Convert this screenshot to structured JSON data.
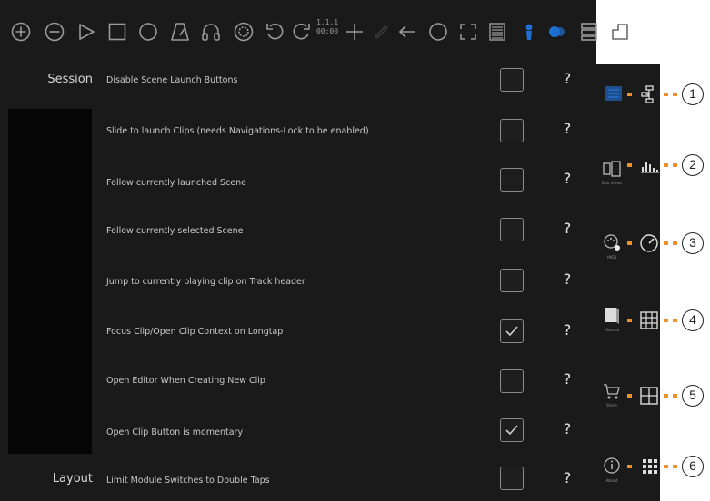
{
  "toolbar": {
    "icons": [
      "plus-circle-icon",
      "minus-circle-icon",
      "play-icon",
      "stop-square-icon",
      "record-circle-icon",
      "metronome-icon",
      "headphones-icon",
      "gear-circle-icon",
      "undo-icon",
      "redo-icon",
      "plus-icon",
      "pen-icon",
      "arrow-left-icon",
      "loop-circle-icon",
      "expand-icon",
      "list-icon",
      "blue-active-icon-1",
      "blue-active-icon-2",
      "stack-icon",
      "corner-icon"
    ],
    "position_top": "1.1.1",
    "position_bottom": "00:00"
  },
  "settings": {
    "session_title": "Session",
    "layout_title": "Layout",
    "rows": [
      {
        "label": "Disable Scene Launch Buttons",
        "checked": false
      },
      {
        "label": "Slide to launch Clips (needs Navigations-Lock to be enabled)",
        "checked": false
      },
      {
        "label": "Follow currently launched Scene",
        "checked": false
      },
      {
        "label": "Follow currently selected Scene",
        "checked": false
      },
      {
        "label": "Jump to currently playing clip on Track header",
        "checked": false
      },
      {
        "label": "Focus Clip/Open Clip Context on Longtap",
        "checked": true
      },
      {
        "label": "Open Editor When Creating New Clip",
        "checked": false
      },
      {
        "label": "Open Clip Button is momentary",
        "checked": true
      },
      {
        "label": "Limit Module Switches to Double Taps",
        "checked": false
      }
    ],
    "help_mark": "?"
  },
  "sidebar": {
    "items": [
      {
        "icon": "settings-active-icon",
        "caption": ""
      },
      {
        "icon": "sub-view-icon",
        "caption": "Sub views"
      },
      {
        "icon": "midi-icon",
        "caption": "MIDI"
      },
      {
        "icon": "manual-icon",
        "caption": "Manual"
      },
      {
        "icon": "cart-icon",
        "caption": "Store"
      },
      {
        "icon": "info-icon",
        "caption": "About"
      }
    ]
  },
  "callouts": [
    {
      "number": "1",
      "icon": "tree-structure-icon"
    },
    {
      "number": "2",
      "icon": "bars-icon"
    },
    {
      "number": "3",
      "icon": "gauge-icon"
    },
    {
      "number": "4",
      "icon": "grid-icon"
    },
    {
      "number": "5",
      "icon": "layout-icon"
    },
    {
      "number": "6",
      "icon": "dots-grid-icon"
    }
  ],
  "colors": {
    "background": "#1a1a1a",
    "accent_blue": "#1e6fd2",
    "callout_orange": "#f0902a"
  }
}
